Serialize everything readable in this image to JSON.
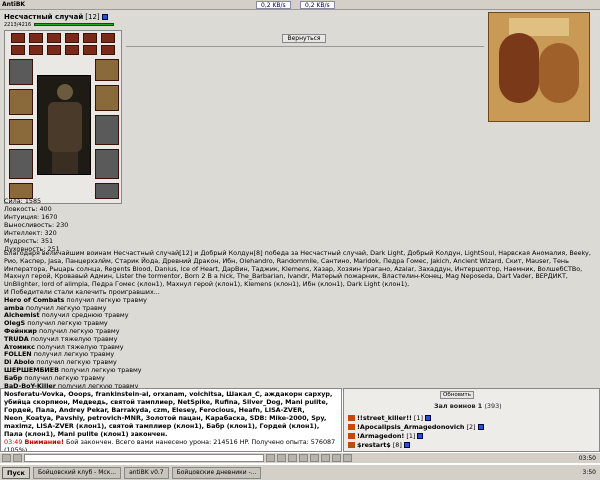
{
  "window": {
    "title": "AntiBK",
    "speed_down": "0,2 KB/s",
    "speed_up": "0,2 KB/s"
  },
  "character": {
    "name": "Несчастный случай",
    "level": "[12]",
    "hp": "2213/4216"
  },
  "stats": [
    {
      "label": "Сила:",
      "value": "1585"
    },
    {
      "label": "Ловкость:",
      "value": "400"
    },
    {
      "label": "Интуиция:",
      "value": "1670"
    },
    {
      "label": "Выносливость:",
      "value": "230"
    },
    {
      "label": "Интеллект:",
      "value": "320"
    },
    {
      "label": "Мудрость:",
      "value": "351"
    },
    {
      "label": "Духовность:",
      "value": "251"
    }
  ],
  "back_button": "Вернуться",
  "battle_log": {
    "summary": "Благодаря величайшим воинам Несчастный случай[12] и Добрый Колдун[8] победа за Несчастный случай, Dark Light, Добрый Колдун, LightSoul, Нарвская Аномалия, Beeky, Рио, Каспер, Jasa, Панцерхэлйм, Старик Йода, Древний Дракон, Ибн, Olehandro, Randommile, Сантино, Maridok, Педра Гомес, Jakich, Ancient Wizard, Скит, Mauser, Тень Императора, Рыцарь солнца, Regents Blood, Danius, Ice of Heart, ДарВин, Таджик, Klemens, Хазар, Хозяин Урагано, Azalar, Захаддун, Интерцептор, Наемник, ВолшебСТВо, Махнул герой, Кровавый Админ, Lister the tormentor, Born 2 B a hick, The_Barbarian, Ivandr, Матерый пожарник, Властелин-Конец, Mag Neposeda, Dart Vader, ВЕРДИКТ, UnBlighter, lord of alimpia, Педра Гомес (клон1), Махнул герой (клон1), Klemens (клон1), Ибн (клон1), Dark Light (клон1),",
    "winners": "И Победители стали калечить проигравших...",
    "injuries": [
      {
        "name": "Hero of Combats",
        "text": "получил легкую травму"
      },
      {
        "name": "amba",
        "text": "получил легкую травму"
      },
      {
        "name": "Alchemist",
        "text": "получил среднюю травму"
      },
      {
        "name": "OlegS",
        "text": "получил легкую травму"
      },
      {
        "name": "Фейнкир",
        "text": "получил легкую травму"
      },
      {
        "name": "TRUDA",
        "text": "получил тяжелую травму"
      },
      {
        "name": "Атомикс",
        "text": "получил тяжелую травму"
      },
      {
        "name": "FOLLEN",
        "text": "получил легкую травму"
      },
      {
        "name": "Di Abolo",
        "text": "получил легкую травму"
      },
      {
        "name": "ШЕРШЕМБИЕВ",
        "text": "получил легкую травму"
      },
      {
        "name": "Бабр",
        "text": "получил легкую травму"
      },
      {
        "name": "BaD-BoY-Killer",
        "text": "получил легкую травму"
      }
    ]
  },
  "chat": {
    "line1": "Nosferatu-Vovka, Ooops, frankinstein-al, orxanam, volchitsa, Шакал_С, аждакорн сархур, убийца скорпион, Медведь, святой тамплиер, NetSpike, Rufina, Silver_Dog, Mani pulite, Гордей, Пала, Andrey Pekar, Barrakyda, czm, Elesey, Ferocious, Heafn, LISA-ZVER, Neon_Koatya, Pavshiy, petrovich-MNR, Золотой пацан, Карабаска, SDB: Mike-2000, Spy, maximz, LISA-ZVER (клон1), святой тамплиер (клон1), Бабр (клон1), Гордей (клон1), Пала (клон1), Mani pulite (клон1) закончен.",
    "warn_time": "03:49",
    "warn_label": "Внимание!",
    "warn_text": "Бой закончен. Всего вами нанесено урона: 214516 HP. Получено опыта: 576087 (105%)"
  },
  "side": {
    "refresh": "Обновить",
    "hall_title": "Зал воинов 1",
    "hall_count": "(393)",
    "users": [
      {
        "name": "!!street_killer!!",
        "level": "[1]"
      },
      {
        "name": "!Apocalipsis_Armagedonovich",
        "level": "[2]"
      },
      {
        "name": "!Armagedon!",
        "level": "[1]"
      },
      {
        "name": "$restart$",
        "level": "[8]"
      }
    ]
  },
  "toolbar": {
    "time": "03:50"
  },
  "taskbar": {
    "start": "Пуск",
    "tasks": [
      "Бойцовский клуб - Мск...",
      "antiBK v0.7",
      "Бойцовские дневники -..."
    ],
    "clock": "3:50"
  }
}
